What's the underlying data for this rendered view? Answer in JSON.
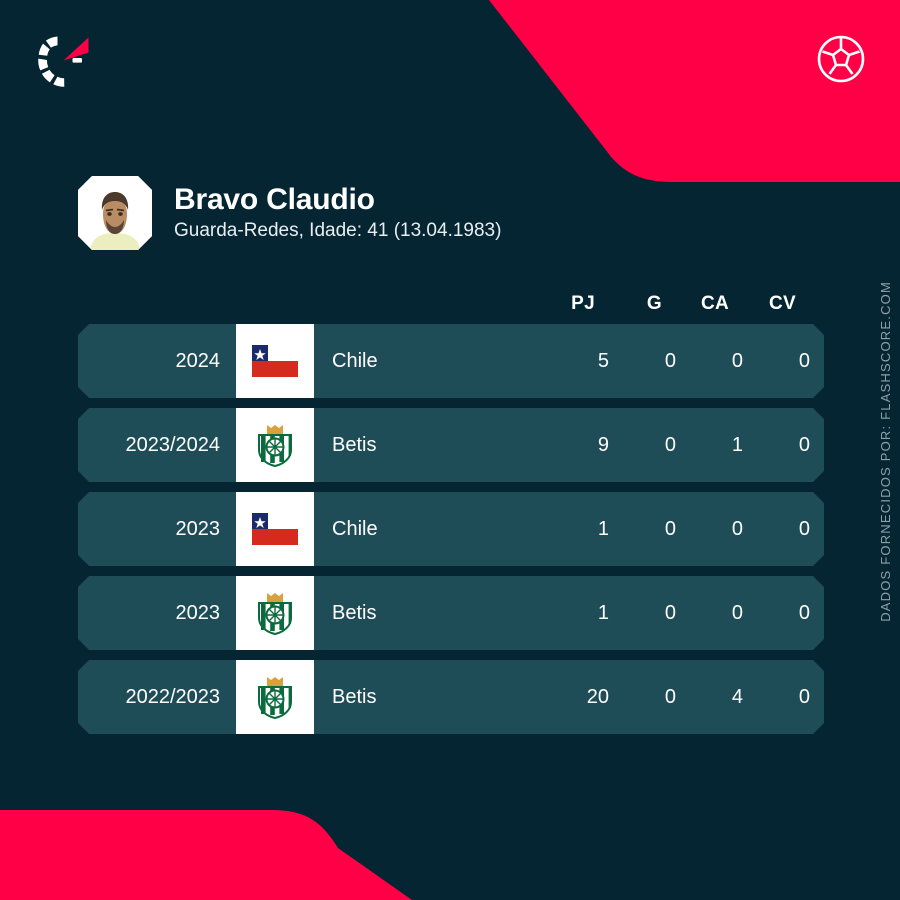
{
  "theme": {
    "background": "#062532",
    "accent_red": "#ff0046",
    "row_background": "#1e4c57",
    "text_primary": "#ffffff",
    "text_muted": "#8ea0a8",
    "badge_background": "#ffffff"
  },
  "header": {
    "logo_icon": "flashscore-logo-icon",
    "ball_icon": "soccer-ball-icon"
  },
  "player": {
    "avatar_icon": "player-portrait-avatar",
    "name": "Bravo Claudio",
    "meta": "Guarda-Redes, Idade: 41 (13.04.1983)"
  },
  "table": {
    "columns": [
      {
        "key": "pj",
        "label": "PJ"
      },
      {
        "key": "g",
        "label": "G"
      },
      {
        "key": "ca",
        "label": "CA"
      },
      {
        "key": "cv",
        "label": "CV"
      }
    ],
    "rows": [
      {
        "season": "2024",
        "badge": "chile-flag-icon",
        "team": "Chile",
        "pj": "5",
        "g": "0",
        "ca": "0",
        "cv": "0"
      },
      {
        "season": "2023/2024",
        "badge": "betis-crest-icon",
        "team": "Betis",
        "pj": "9",
        "g": "0",
        "ca": "1",
        "cv": "0"
      },
      {
        "season": "2023",
        "badge": "chile-flag-icon",
        "team": "Chile",
        "pj": "1",
        "g": "0",
        "ca": "0",
        "cv": "0"
      },
      {
        "season": "2023",
        "badge": "betis-crest-icon",
        "team": "Betis",
        "pj": "1",
        "g": "0",
        "ca": "0",
        "cv": "0"
      },
      {
        "season": "2022/2023",
        "badge": "betis-crest-icon",
        "team": "Betis",
        "pj": "20",
        "g": "0",
        "ca": "4",
        "cv": "0"
      }
    ]
  },
  "footer": {
    "credit": "DADOS FORNECIDOS POR: FLASHSCORE.COM"
  }
}
